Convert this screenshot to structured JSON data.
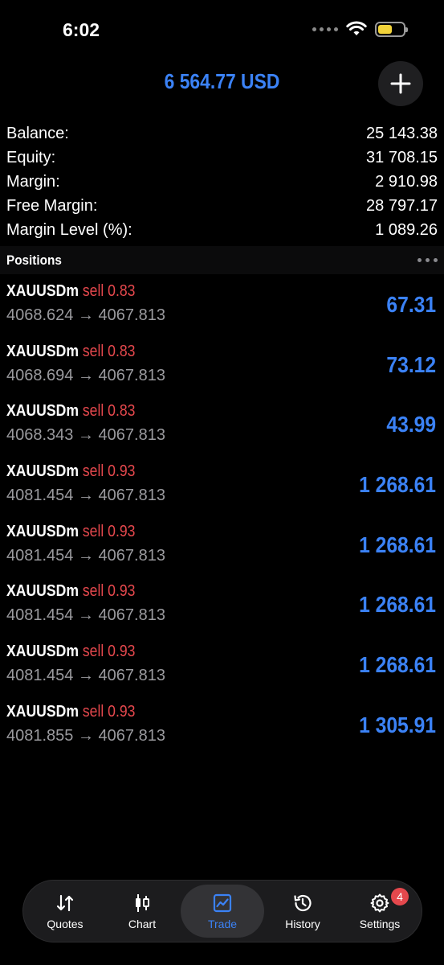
{
  "status": {
    "time": "6:02"
  },
  "header": {
    "equity_display": "6 564.77 USD",
    "add_button_icon": "plus-icon"
  },
  "summary": [
    {
      "label": "Balance:",
      "value": "25 143.38"
    },
    {
      "label": "Equity:",
      "value": "31 708.15"
    },
    {
      "label": "Margin:",
      "value": "2 910.98"
    },
    {
      "label": "Free Margin:",
      "value": "28 797.17"
    },
    {
      "label": "Margin Level (%):",
      "value": "1 089.26"
    }
  ],
  "positions": {
    "title": "Positions",
    "items": [
      {
        "symbol": "XAUUSDm",
        "side": "sell 0.83",
        "open": "4068.624",
        "arrow": "→",
        "current": "4067.813",
        "profit": "67.31"
      },
      {
        "symbol": "XAUUSDm",
        "side": "sell 0.83",
        "open": "4068.694",
        "arrow": "→",
        "current": "4067.813",
        "profit": "73.12"
      },
      {
        "symbol": "XAUUSDm",
        "side": "sell 0.83",
        "open": "4068.343",
        "arrow": "→",
        "current": "4067.813",
        "profit": "43.99"
      },
      {
        "symbol": "XAUUSDm",
        "side": "sell 0.93",
        "open": "4081.454",
        "arrow": "→",
        "current": "4067.813",
        "profit": "1 268.61"
      },
      {
        "symbol": "XAUUSDm",
        "side": "sell 0.93",
        "open": "4081.454",
        "arrow": "→",
        "current": "4067.813",
        "profit": "1 268.61"
      },
      {
        "symbol": "XAUUSDm",
        "side": "sell 0.93",
        "open": "4081.454",
        "arrow": "→",
        "current": "4067.813",
        "profit": "1 268.61"
      },
      {
        "symbol": "XAUUSDm",
        "side": "sell 0.93",
        "open": "4081.454",
        "arrow": "→",
        "current": "4067.813",
        "profit": "1 268.61"
      },
      {
        "symbol": "XAUUSDm",
        "side": "sell 0.93",
        "open": "4081.855",
        "arrow": "→",
        "current": "4067.813",
        "profit": "1 305.91"
      }
    ]
  },
  "tabs": [
    {
      "label": "Quotes",
      "icon": "quotes-icon"
    },
    {
      "label": "Chart",
      "icon": "candlestick-icon"
    },
    {
      "label": "Trade",
      "icon": "trade-chart-icon",
      "active": true
    },
    {
      "label": "History",
      "icon": "history-icon"
    },
    {
      "label": "Settings",
      "icon": "gear-icon",
      "badge": "4"
    }
  ],
  "colors": {
    "accent": "#3b82f6",
    "sell": "#e5484d",
    "background": "#000000",
    "badge": "#e5484d"
  }
}
